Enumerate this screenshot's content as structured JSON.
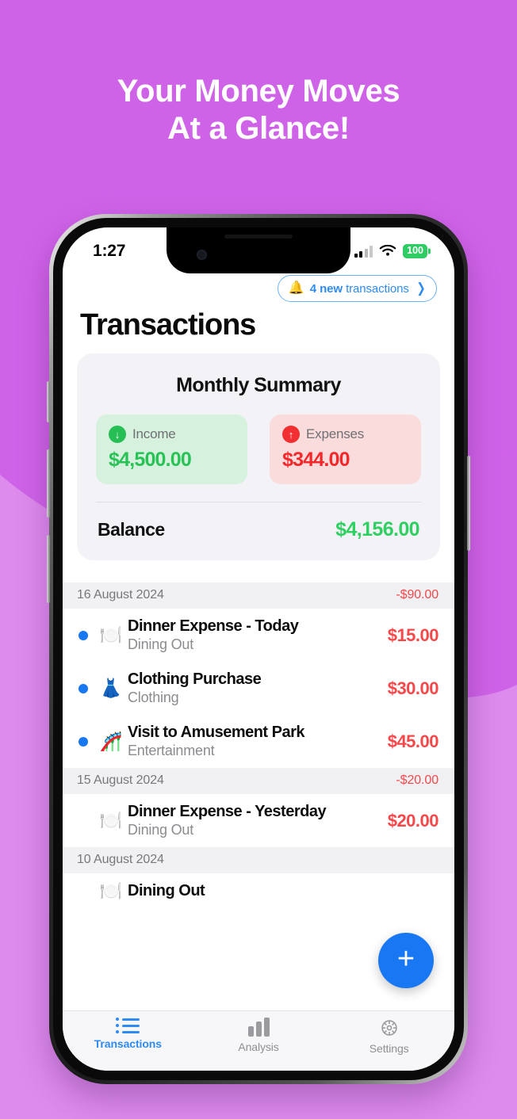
{
  "promo": {
    "headline_line1": "Your Money Moves",
    "headline_line2": "At a Glance!",
    "bg_color": "#dd8bed",
    "blob_color": "#cf63e8"
  },
  "status_bar": {
    "time": "1:27",
    "battery": "100",
    "battery_color": "#2ecc63",
    "signal_icon": "cellular-signal-icon",
    "wifi_icon": "wifi-icon"
  },
  "header": {
    "notification": {
      "bell_icon": "bell-icon",
      "count_text": "4 new",
      "rest_text": "transactions",
      "chevron_icon": "chevron-right-icon",
      "accent_color": "#2e8bf5"
    },
    "title": "Transactions"
  },
  "summary": {
    "title": "Monthly Summary",
    "income": {
      "label": "Income",
      "value": "$4,500.00",
      "icon": "arrow-down-icon",
      "color": "#29c257",
      "bg": "#d6f2de"
    },
    "expenses": {
      "label": "Expenses",
      "value": "$344.00",
      "icon": "arrow-up-icon",
      "color": "#f4282b",
      "bg": "#fbdcdc"
    },
    "balance": {
      "label": "Balance",
      "value": "$4,156.00",
      "color": "#2fd061"
    }
  },
  "transactions": {
    "groups": [
      {
        "date": "16 August 2024",
        "total": "-$90.00",
        "items": [
          {
            "unread": true,
            "emoji": "🍽️",
            "emoji_name": "dining-icon",
            "title": "Dinner Expense - Today",
            "category": "Dining Out",
            "amount": "$15.00"
          },
          {
            "unread": true,
            "emoji": "👗",
            "emoji_name": "clothing-icon",
            "title": "Clothing Purchase",
            "category": "Clothing",
            "amount": "$30.00"
          },
          {
            "unread": true,
            "emoji": "🎢",
            "emoji_name": "amusement-park-icon",
            "title": "Visit to Amusement Park",
            "category": "Entertainment",
            "amount": "$45.00"
          }
        ]
      },
      {
        "date": "15 August 2024",
        "total": "-$20.00",
        "items": [
          {
            "unread": false,
            "emoji": "🍽️",
            "emoji_name": "dining-icon",
            "title": "Dinner Expense - Yesterday",
            "category": "Dining Out",
            "amount": "$20.00"
          }
        ]
      },
      {
        "date": "10 August 2024",
        "total": "",
        "items": [
          {
            "unread": false,
            "emoji": "🍽️",
            "emoji_name": "dining-icon",
            "title": "Dining Out",
            "category": "",
            "amount": ""
          }
        ]
      }
    ]
  },
  "fab": {
    "icon": "plus-icon",
    "label": "+",
    "color": "#1877f2"
  },
  "tabbar": {
    "items": [
      {
        "label": "Transactions",
        "icon": "list-icon",
        "active": true
      },
      {
        "label": "Analysis",
        "icon": "bar-chart-icon",
        "active": false
      },
      {
        "label": "Settings",
        "icon": "gear-icon",
        "active": false
      }
    ]
  }
}
